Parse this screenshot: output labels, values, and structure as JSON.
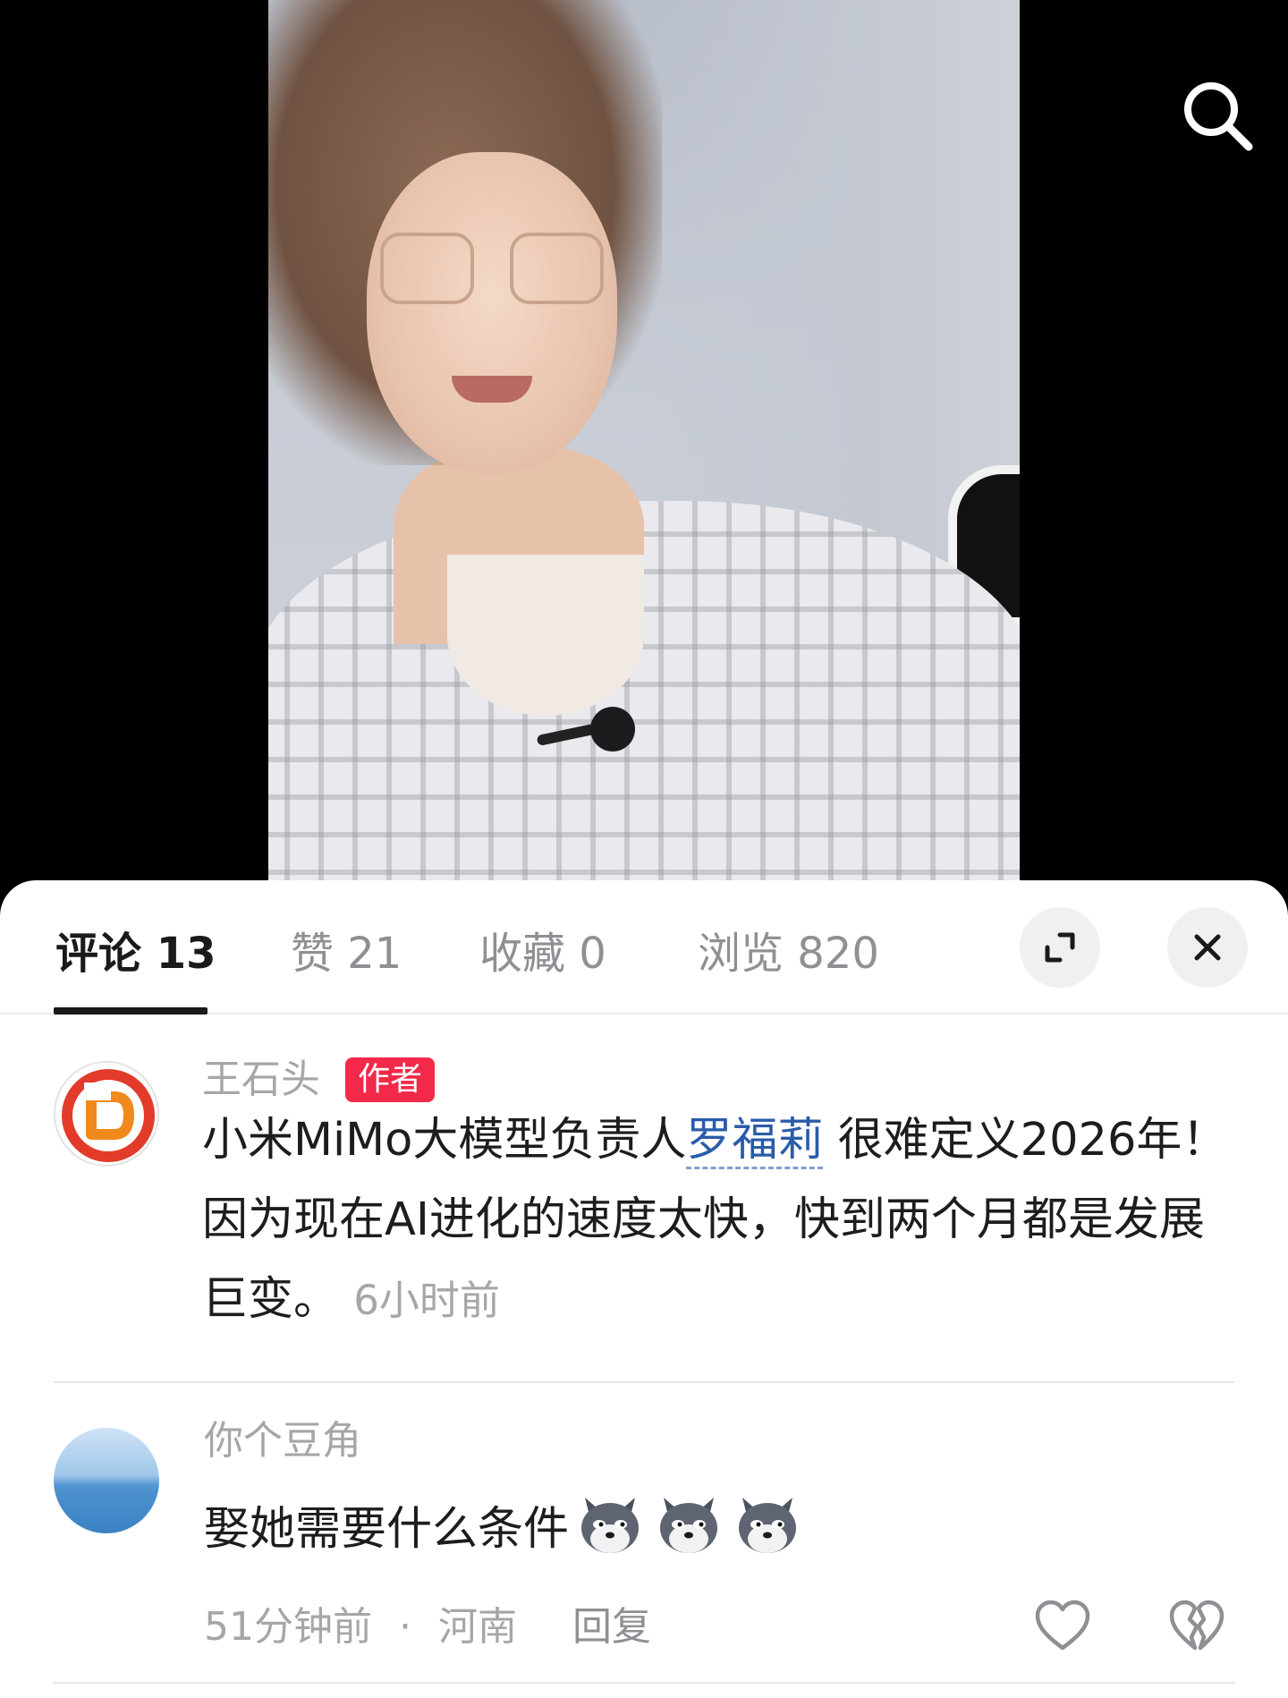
{
  "tabs": [
    {
      "label": "评论 13",
      "active": true
    },
    {
      "label": "赞 21",
      "active": false
    },
    {
      "label": "收藏 0",
      "active": false
    },
    {
      "label": "浏览 820",
      "active": false
    }
  ],
  "comments": [
    {
      "username": "王石头",
      "badge": "作者",
      "text_before": "小米MiMo大模型负责人",
      "mention": "罗福莉",
      "text_after": " 很难定义2026年！因为现在AI进化的速度太快，快到两个月都是发展巨变。",
      "time": "6小时前"
    },
    {
      "username": "你个豆角",
      "text": "娶她需要什么条件",
      "emoji_icon": "doge-wolf-emoji",
      "time": "51分钟前",
      "separator": "·",
      "location": "河南",
      "reply_label": "回复"
    }
  ],
  "colors": {
    "badge": "#f3294a",
    "mention": "#2a5ca8",
    "muted": "#a6a6aa"
  }
}
